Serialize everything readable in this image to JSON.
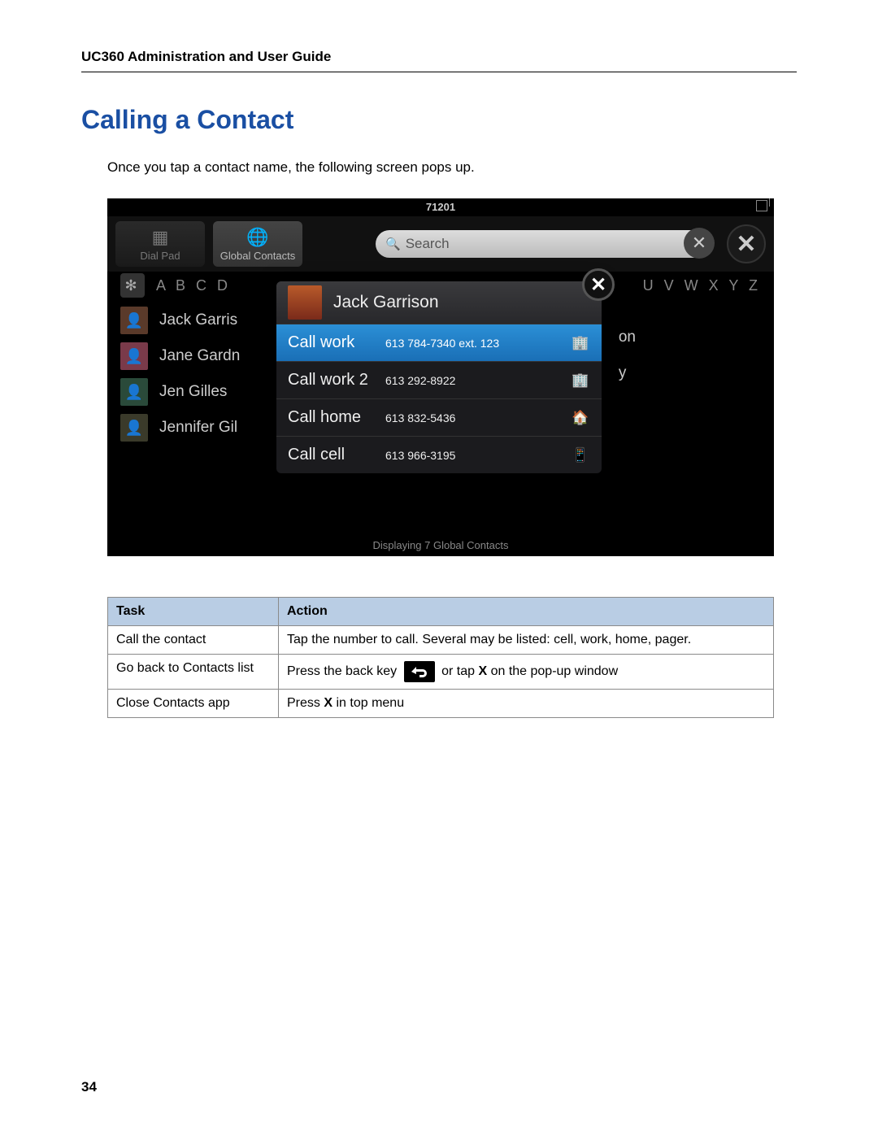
{
  "doc": {
    "header": "UC360 Administration and User Guide",
    "section_title": "Calling a Contact",
    "intro": "Once you tap a contact name, the following screen pops up.",
    "page_number": "34"
  },
  "screenshot": {
    "status_number": "71201",
    "toolbar": {
      "dialpad": "Dial Pad",
      "global_contacts": "Global Contacts",
      "search_placeholder": "Search"
    },
    "alpha_left": "A B C D",
    "alpha_right": "U V W X Y Z",
    "contacts": [
      "Jack Garris",
      "Jane Gardn",
      "Jen Gilles",
      "Jennifer Gil"
    ],
    "right_hints": [
      "on",
      "y"
    ],
    "footer": "Displaying 7 Global Contacts",
    "popup": {
      "name": "Jack Garrison",
      "rows": [
        {
          "label": "Call work",
          "number": "613 784-7340 ext. 123",
          "icon": "building",
          "selected": true
        },
        {
          "label": "Call work 2",
          "number": "613 292-8922",
          "icon": "building",
          "selected": false
        },
        {
          "label": "Call home",
          "number": "613 832-5436",
          "icon": "home",
          "selected": false
        },
        {
          "label": "Call cell",
          "number": "613 966-3195",
          "icon": "cell",
          "selected": false
        }
      ]
    }
  },
  "table": {
    "headers": {
      "task": "Task",
      "action": "Action"
    },
    "rows": [
      {
        "task": "Call the contact",
        "action": "Tap the number to call. Several may be listed: cell, work, home, pager."
      },
      {
        "task": "Go back to Contacts list",
        "action_pre": "Press the back key",
        "action_post": "or tap",
        "action_bold": "X",
        "action_tail": "on the pop-up window"
      },
      {
        "task": "Close Contacts app",
        "action_pre2": "Press",
        "action_bold2": "X",
        "action_tail2": "in top menu"
      }
    ]
  }
}
